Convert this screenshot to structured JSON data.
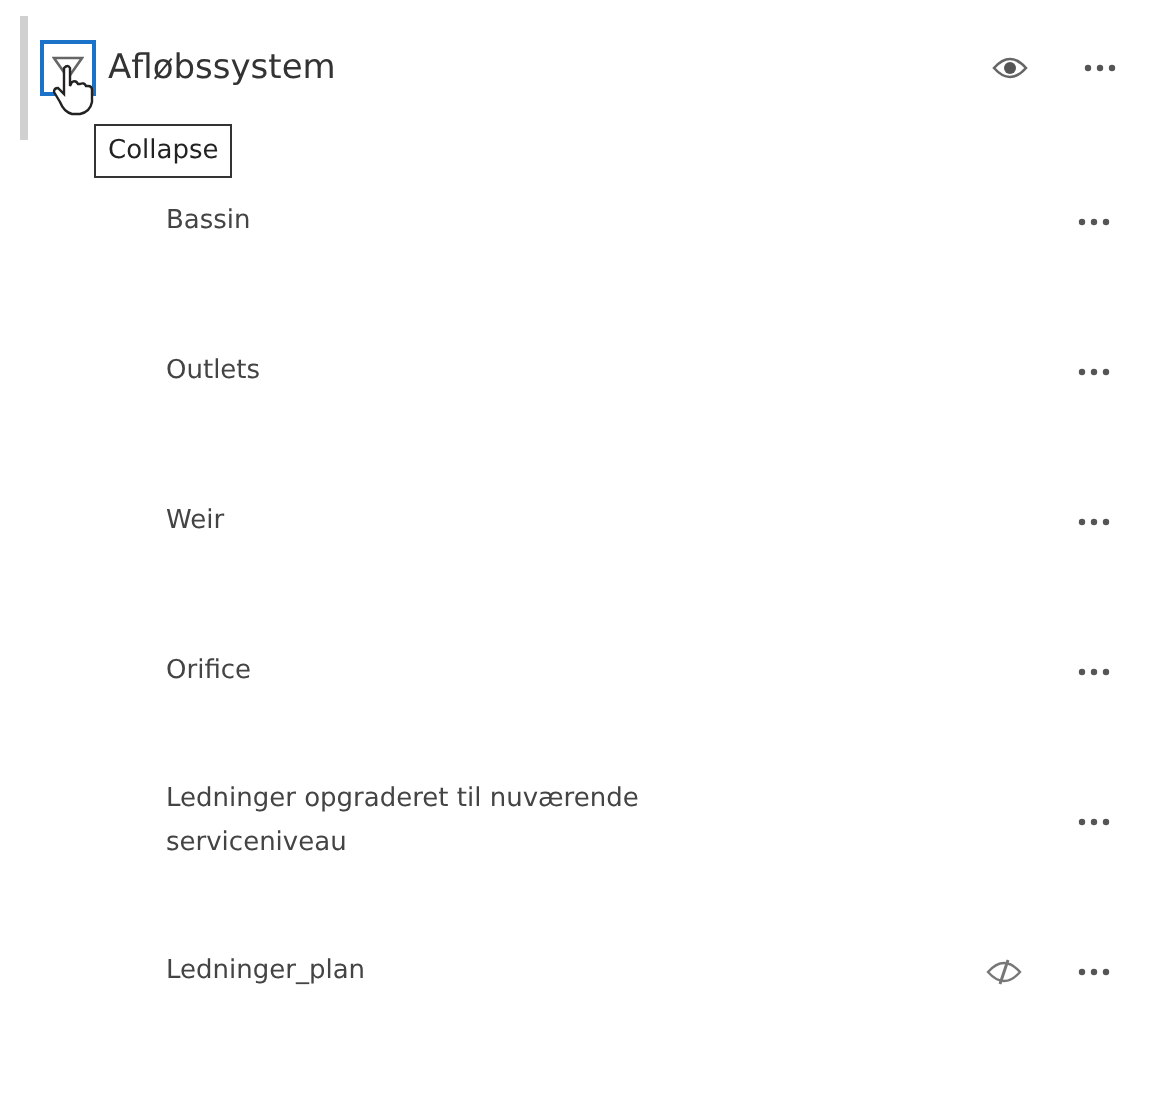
{
  "group": {
    "title": "Afløbssystem",
    "expanded": true,
    "visible": true,
    "tooltip": "Collapse"
  },
  "layers": [
    {
      "name": "Bassin"
    },
    {
      "name": "Outlets"
    },
    {
      "name": "Weir"
    },
    {
      "name": "Orifice"
    },
    {
      "name": "Ledninger opgraderet til nuværende serviceniveau"
    },
    {
      "name": "Ledninger_plan",
      "visible": false
    }
  ]
}
